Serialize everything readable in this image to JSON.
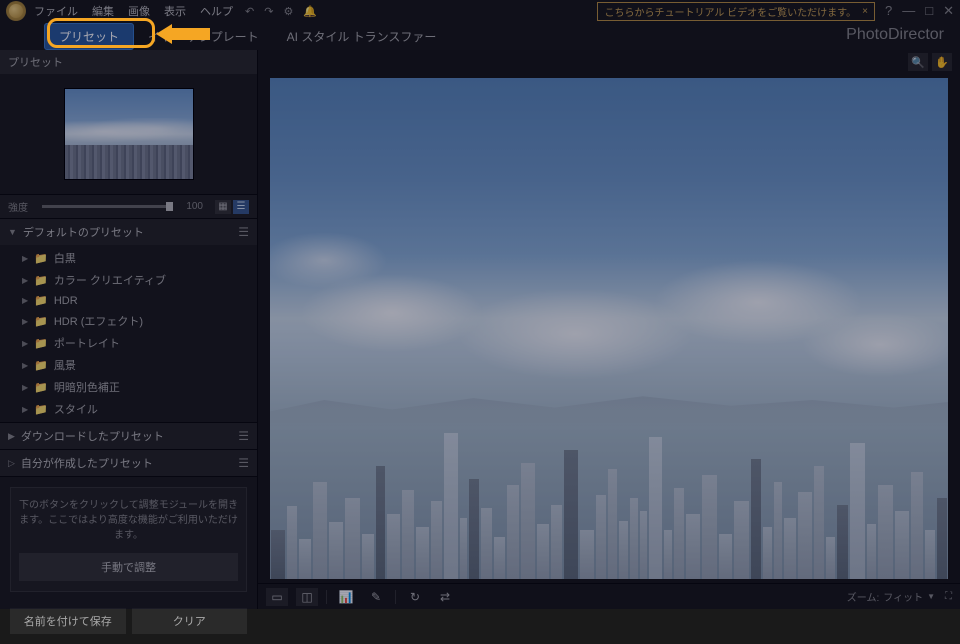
{
  "menubar": {
    "items": [
      "ファイル",
      "編集",
      "画像",
      "表示",
      "ヘルプ"
    ],
    "tutorial_text": "こちらからチュートリアル ビデオをご覧いただけます。",
    "tutorial_close": "×"
  },
  "brand": "PhotoDirector",
  "tabs": {
    "preset": "プリセット",
    "layer_template": "イヤー テンプレート",
    "ai_style": "AI スタイル トランスファー"
  },
  "sidebar": {
    "title": "プリセット",
    "strength_label": "強度",
    "strength_value": "100",
    "sections": {
      "default": {
        "title": "デフォルトのプリセット",
        "items": [
          "白黒",
          "カラー クリエイティブ",
          "HDR",
          "HDR (エフェクト)",
          "ポートレイト",
          "風景",
          "明暗別色補正",
          "スタイル"
        ]
      },
      "downloaded": {
        "title": "ダウンロードしたプリセット"
      },
      "custom": {
        "title": "自分が作成したプリセット"
      }
    },
    "help_text": "下のボタンをクリックして調整モジュールを開きます。ここではより高度な機能がご利用いただけます。",
    "manual_btn": "手動で調整",
    "save_as": "名前を付けて保存",
    "clear": "クリア"
  },
  "footer": {
    "zoom_label": "ズーム:",
    "zoom_value": "フィット"
  }
}
